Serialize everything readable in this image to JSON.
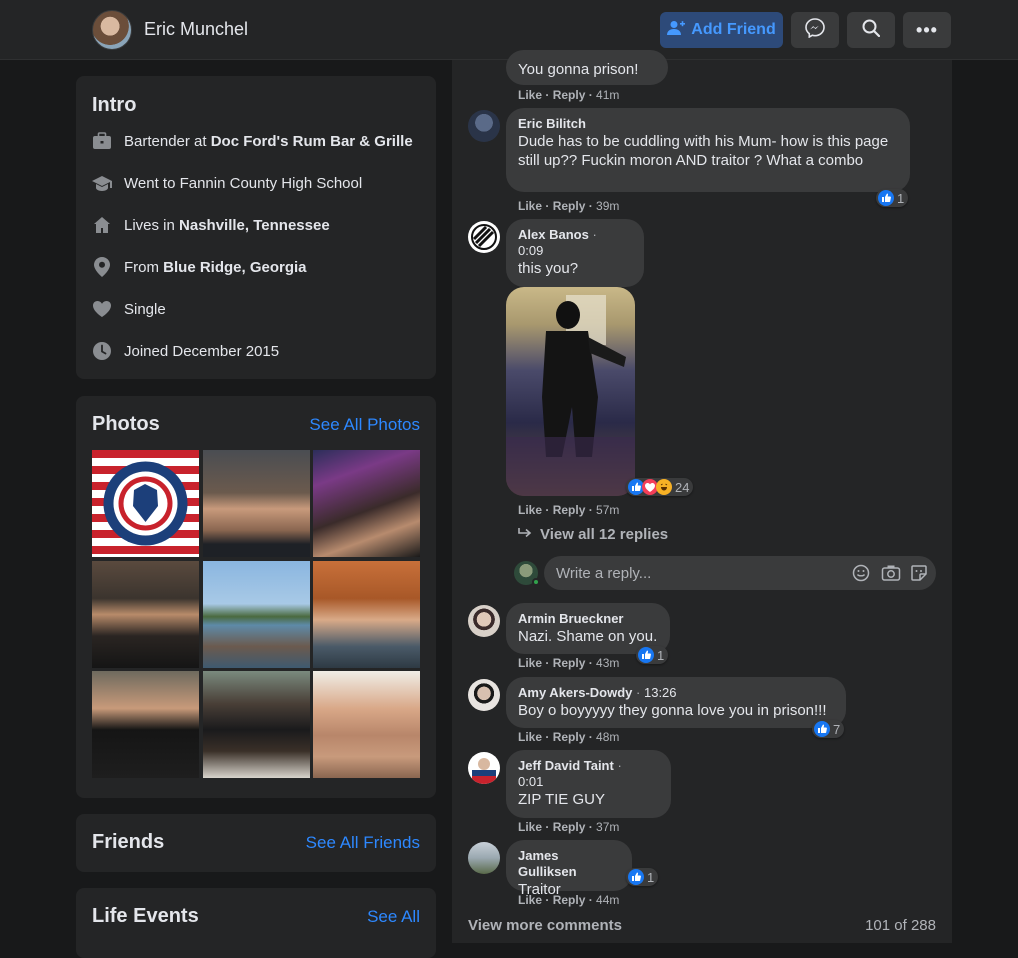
{
  "header": {
    "name": "Eric Munchel",
    "add_friend": "Add Friend"
  },
  "intro": {
    "title": "Intro",
    "work_prefix": "Bartender at ",
    "work_place": "Doc Ford's Rum Bar & Grille",
    "education": "Went to Fannin County High School",
    "lives_prefix": "Lives in ",
    "lives_place": "Nashville, Tennessee",
    "from_prefix": "From ",
    "from_place": "Blue Ridge, Georgia",
    "relationship": "Single",
    "joined": "Joined December 2015"
  },
  "photos": {
    "title": "Photos",
    "see_all": "See All Photos"
  },
  "friends": {
    "title": "Friends",
    "see_all": "See All Friends"
  },
  "life_events": {
    "title": "Life Events",
    "see_all": "See All"
  },
  "comments": [
    {
      "text": "You gonna prison!",
      "like": "Like",
      "reply": "Reply",
      "time": "41m"
    },
    {
      "author": "Eric Bilitch",
      "text": "Dude has to be cuddling with his Mum- how is this page still up?? Fuckin moron AND traitor ? What a combo",
      "like": "Like",
      "reply": "Reply",
      "time": "39m",
      "reactions": "1"
    },
    {
      "author": "Alex Banos",
      "sep": "·",
      "timestamp": "0:09",
      "text": "this you?",
      "like": "Like",
      "reply": "Reply",
      "time": "57m",
      "reactions": "24"
    },
    {
      "author": "Armin Brueckner",
      "text": "Nazi. Shame on you.",
      "like": "Like",
      "reply": "Reply",
      "time": "43m",
      "reactions": "1"
    },
    {
      "author": "Amy Akers-Dowdy",
      "sep": "·",
      "timestamp": "13:26",
      "text": "Boy o boyyyyy they gonna love you in prison!!!",
      "like": "Like",
      "reply": "Reply",
      "time": "48m",
      "reactions": "7"
    },
    {
      "author": "Jeff David Taint",
      "sep": "·",
      "timestamp": "0:01",
      "text": "ZIP TIE GUY",
      "like": "Like",
      "reply": "Reply",
      "time": "37m"
    },
    {
      "author": "James Gulliksen",
      "text": "Traitor",
      "like": "Like",
      "reply": "Reply",
      "time": "44m",
      "reactions": "1"
    }
  ],
  "view_replies": "View all 12 replies",
  "reply_placeholder": "Write a reply...",
  "view_more": "View more comments",
  "count": "101 of 288",
  "colors": {
    "accent": "#2d88ff",
    "surface": "#242526",
    "bubble": "#3a3b3c",
    "background": "#18191a"
  }
}
